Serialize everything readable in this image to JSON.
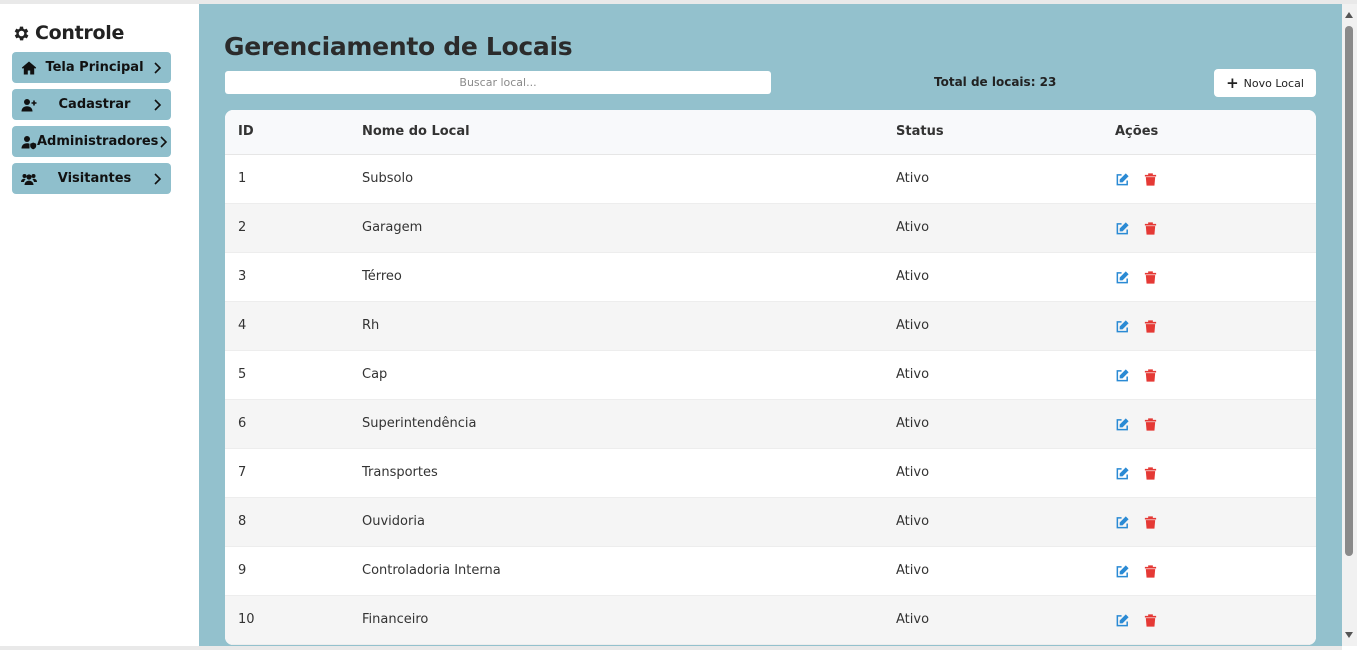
{
  "sidebar": {
    "brand": "Controle",
    "items": [
      {
        "label": "Tela Principal"
      },
      {
        "label": "Cadastrar"
      },
      {
        "label": "Administradores"
      },
      {
        "label": "Visitantes"
      }
    ]
  },
  "main": {
    "title": "Gerenciamento de Locais",
    "search": {
      "placeholder": "Buscar local...",
      "value": ""
    },
    "total": "Total de locais: 23",
    "new_button": "Novo Local",
    "table": {
      "headers": [
        "ID",
        "Nome do Local",
        "Status",
        "Ações"
      ],
      "rows": [
        {
          "id": "1",
          "name": "Subsolo",
          "status": "Ativo"
        },
        {
          "id": "2",
          "name": "Garagem",
          "status": "Ativo"
        },
        {
          "id": "3",
          "name": "Térreo",
          "status": "Ativo"
        },
        {
          "id": "4",
          "name": "Rh",
          "status": "Ativo"
        },
        {
          "id": "5",
          "name": "Cap",
          "status": "Ativo"
        },
        {
          "id": "6",
          "name": "Superintendência",
          "status": "Ativo"
        },
        {
          "id": "7",
          "name": "Transportes",
          "status": "Ativo"
        },
        {
          "id": "8",
          "name": "Ouvidoria",
          "status": "Ativo"
        },
        {
          "id": "9",
          "name": "Controladoria Interna",
          "status": "Ativo"
        },
        {
          "id": "10",
          "name": "Financeiro",
          "status": "Ativo"
        }
      ]
    }
  },
  "colors": {
    "main_bg": "#93c1cd",
    "nav_bg": "#8fbfcc",
    "edit_icon": "#2a8ad4",
    "delete_icon": "#e53935"
  },
  "icons": {
    "brand": "gear-icon",
    "nav": [
      "home-icon",
      "user-plus-icon",
      "user-shield-icon",
      "users-icon"
    ],
    "row_actions": [
      "edit-icon",
      "trash-icon"
    ]
  }
}
